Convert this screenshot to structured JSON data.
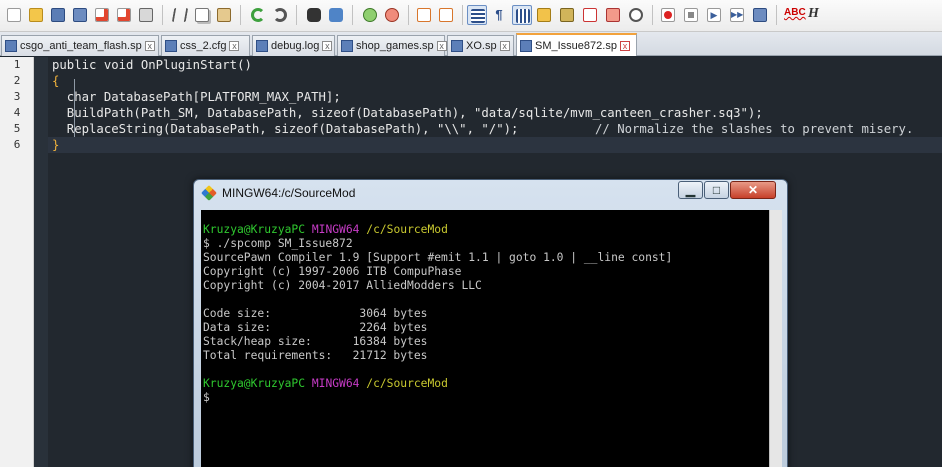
{
  "toolbar": {
    "icons": [
      "new-file-icon",
      "open-folder-icon",
      "save-icon",
      "save-all-icon",
      "close-icon",
      "close-all-icon",
      "print-icon",
      "cut-icon",
      "copy-icon",
      "paste-icon",
      "undo-icon",
      "redo-icon",
      "find-icon",
      "replace-icon",
      "zoom-in-icon",
      "zoom-out-icon",
      "sync-vertical-icon",
      "sync-horizontal-icon",
      "word-wrap-icon",
      "show-all-chars-icon",
      "indent-guide-icon",
      "user-language-icon",
      "doc-map-icon",
      "function-list-icon",
      "folder-workspace-icon",
      "monitoring-icon",
      "record-macro-icon",
      "stop-macro-icon",
      "play-macro-icon",
      "run-macro-multiple-icon",
      "save-macro-icon",
      "spell-check-icon",
      "hex-icon"
    ],
    "spell_label": "ABC",
    "h_label": "H"
  },
  "tabs": [
    {
      "label": "csgo_anti_team_flash.sp",
      "close": "x"
    },
    {
      "label": "css_2.cfg",
      "close": "x"
    },
    {
      "label": "debug.log",
      "close": "x"
    },
    {
      "label": "shop_games.sp",
      "close": "x"
    },
    {
      "label": "XO.sp",
      "close": "x"
    },
    {
      "label": "SM_Issue872.sp",
      "close": "x",
      "active": true
    }
  ],
  "editor": {
    "line_numbers": [
      "1",
      "2",
      "3",
      "4",
      "5",
      "6"
    ],
    "lines": [
      "public void OnPluginStart()",
      "{",
      "  char DatabasePath[PLATFORM_MAX_PATH];",
      "  BuildPath(Path_SM, DatabasePath, sizeof(DatabasePath), \"data/sqlite/mvm_canteen_crasher.sq3\");",
      "  ReplaceString(DatabasePath, sizeof(DatabasePath), \"\\\\\", \"/\");",
      "}"
    ],
    "comment_line5": "// Normalize the slashes to prevent misery."
  },
  "terminal": {
    "title": "MINGW64:/c/SourceMod",
    "min_glyph": "▁",
    "max_glyph": "□",
    "close_glyph": "✕",
    "prompt1": {
      "user": "Kruzya@KruzyaPC",
      "env": "MINGW64",
      "path": "/c/SourceMod"
    },
    "command": "$ ./spcomp SM_Issue872",
    "output": [
      "SourcePawn Compiler 1.9 [Support #emit 1.1 | goto 1.0 | __line const]",
      "Copyright (c) 1997-2006 ITB CompuPhase",
      "Copyright (c) 2004-2017 AlliedModders LLC",
      "",
      "Code size:             3064 bytes",
      "Data size:             2264 bytes",
      "Stack/heap size:      16384 bytes",
      "Total requirements:   21712 bytes"
    ],
    "prompt2": {
      "user": "Kruzya@KruzyaPC",
      "env": "MINGW64",
      "path": "/c/SourceMod"
    },
    "cursor_line": "$"
  }
}
